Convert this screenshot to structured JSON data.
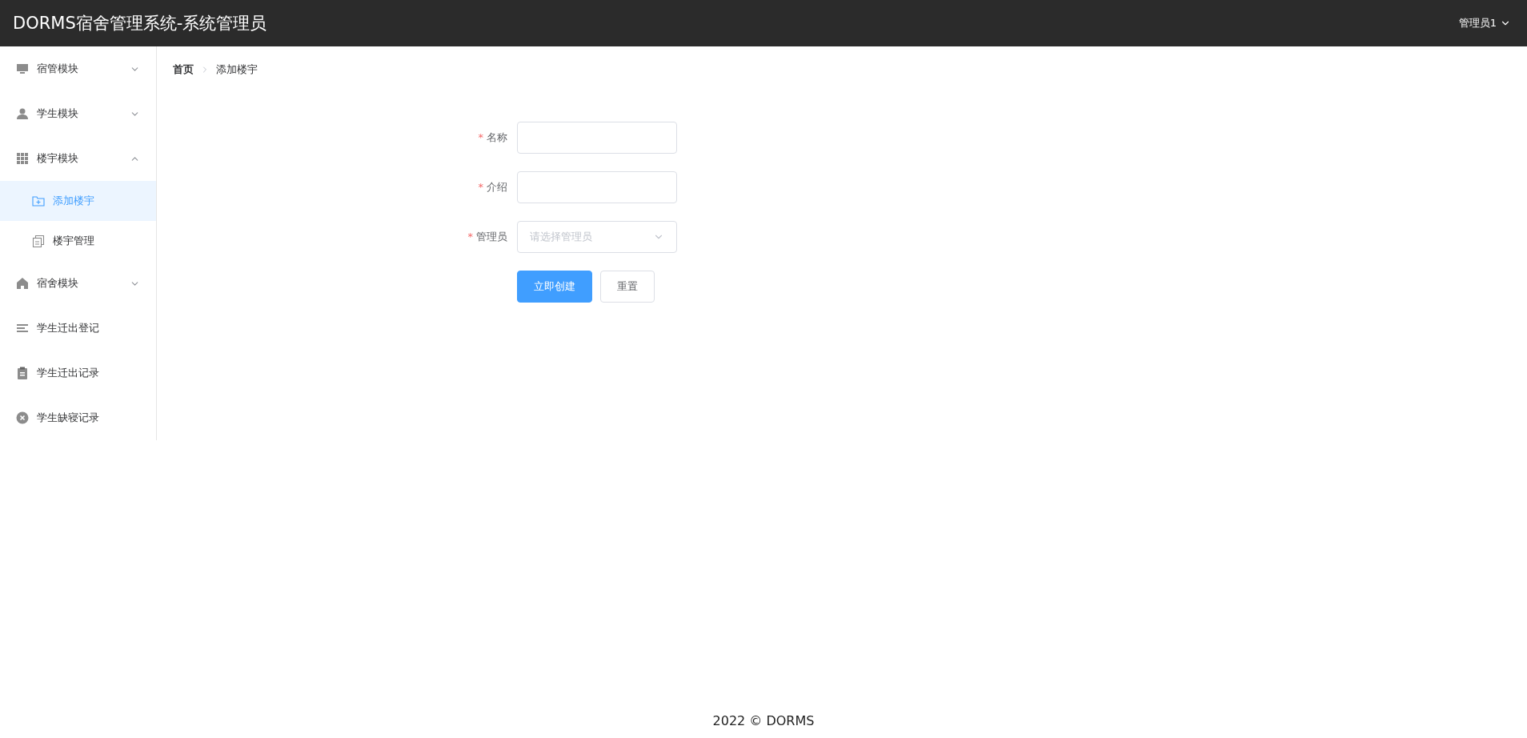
{
  "header": {
    "title": "DORMS宿舍管理系统-系统管理员",
    "user": "管理员1"
  },
  "sidebar": {
    "items": [
      {
        "label": "宿管模块",
        "kind": "submenu",
        "expanded": false,
        "selected": false
      },
      {
        "label": "学生模块",
        "kind": "submenu",
        "expanded": false,
        "selected": false
      },
      {
        "label": "楼宇模块",
        "kind": "submenu",
        "expanded": true,
        "selected": false,
        "children": [
          {
            "label": "添加楼宇",
            "selected": true
          },
          {
            "label": "楼宇管理",
            "selected": false
          }
        ]
      },
      {
        "label": "宿舍模块",
        "kind": "submenu",
        "expanded": false,
        "selected": false
      },
      {
        "label": "学生迁出登记",
        "kind": "item",
        "selected": false
      },
      {
        "label": "学生迁出记录",
        "kind": "item",
        "selected": false
      },
      {
        "label": "学生缺寝记录",
        "kind": "item",
        "selected": false
      }
    ]
  },
  "breadcrumb": [
    "首页",
    "添加楼宇"
  ],
  "form": {
    "fields": [
      {
        "label": "名称",
        "kind": "input",
        "required_mark": "*"
      },
      {
        "label": "介绍",
        "kind": "input",
        "required_mark": "*"
      },
      {
        "label": "管理员",
        "kind": "select",
        "required_mark": "*",
        "placeholder": "请选择管理员"
      }
    ],
    "buttons": [
      {
        "label": "立即创建",
        "kind": "primary"
      },
      {
        "label": "重置",
        "kind": "default"
      }
    ]
  },
  "footer": "2022 © DORMS"
}
